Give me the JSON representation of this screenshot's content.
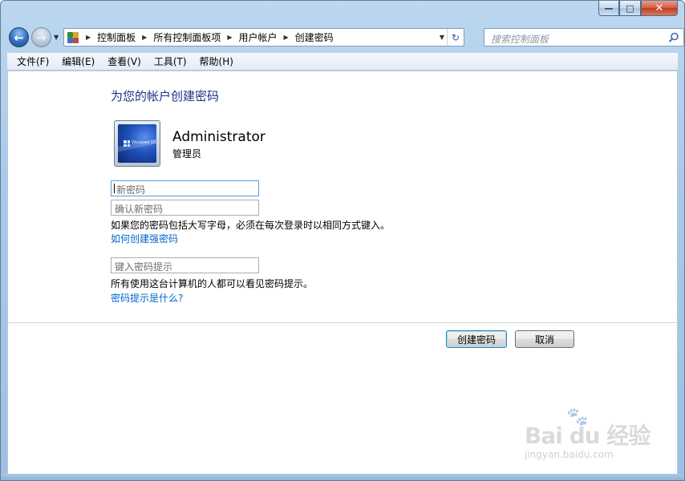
{
  "window": {
    "minimize_glyph": "—",
    "maximize_glyph": "□",
    "close_glyph": "✕"
  },
  "nav": {
    "back_icon": "back-arrow-icon",
    "forward_icon": "forward-arrow-icon",
    "back_glyph": "←",
    "forward_glyph": "→",
    "recent_glyph": "▼"
  },
  "address": {
    "breadcrumb": [
      "控制面板",
      "所有控制面板项",
      "用户帐户",
      "创建密码"
    ],
    "separator_glyph": "▶",
    "dropdown_glyph": "▼",
    "refresh_glyph": "↻"
  },
  "search": {
    "placeholder": "搜索控制面板"
  },
  "menu": {
    "items": [
      "文件(F)",
      "编辑(E)",
      "查看(V)",
      "工具(T)",
      "帮助(H)"
    ]
  },
  "page": {
    "title": "为您的帐户创建密码",
    "user": {
      "name": "Administrator",
      "role": "管理员",
      "tile_text": "Windows 10"
    },
    "new_password_placeholder": "新密码",
    "confirm_password_placeholder": "确认新密码",
    "case_note": "如果您的密码包括大写字母，必须在每次登录时以相同方式键入。",
    "strong_password_link": "如何创建强密码",
    "hint_placeholder": "键入密码提示",
    "hint_note": "所有使用这台计算机的人都可以看见密码提示。",
    "hint_link": "密码提示是什么?",
    "create_button": "创建密码",
    "cancel_button": "取消"
  },
  "watermark": {
    "brand": "Bai du 经验",
    "url": "jingyan.baidu.com"
  },
  "colors": {
    "title_blue": "#1e3287",
    "link_blue": "#0066cc",
    "frame_blue": "#a9c9e8"
  }
}
